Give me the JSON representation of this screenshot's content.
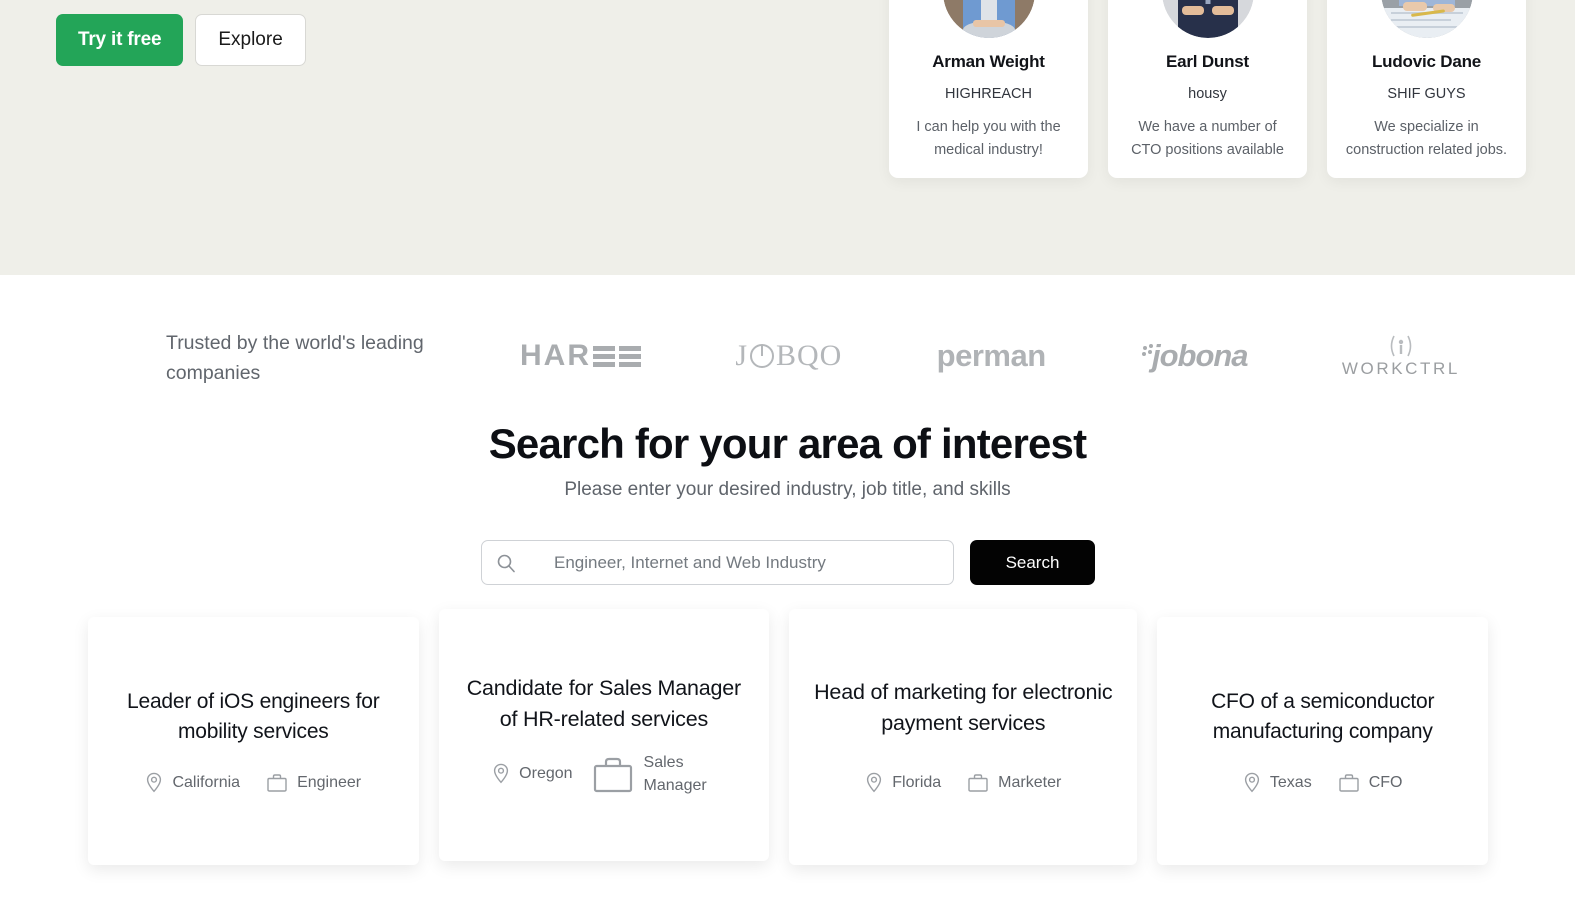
{
  "hero": {
    "primary_cta": "Try it free",
    "secondary_cta": "Explore",
    "background_color": "#efefe9"
  },
  "person_cards": [
    {
      "name": "Arman Weight",
      "company": "HIGHREACH",
      "quote": "I can help you with the medical industry!",
      "avatar": "avatar-photo-woman-denim"
    },
    {
      "name": "Earl Dunst",
      "company": "housy",
      "quote": "We have a number of CTO positions available",
      "avatar": "avatar-photo-man-suit"
    },
    {
      "name": "Ludovic Dane",
      "company": "SHIF GUYS",
      "quote": "We specialize in construction related jobs.",
      "avatar": "avatar-photo-person-desk"
    }
  ],
  "trusted": {
    "label": "Trusted by the world's leading companies",
    "logos": [
      {
        "name": "HAREE",
        "icon": "haree-logo"
      },
      {
        "name": "JOBQO",
        "icon": "jobqo-logo"
      },
      {
        "name": "perman",
        "icon": "perman-logo"
      },
      {
        "name": "jobona",
        "icon": "jobona-logo"
      },
      {
        "name": "WORKCTRL",
        "icon": "workctrl-logo"
      }
    ]
  },
  "search": {
    "title": "Search for your area of interest",
    "subtitle": "Please enter your desired industry, job title, and skills",
    "placeholder": "Engineer, Internet and Web Industry",
    "value": "",
    "button_label": "Search",
    "button_color": "#030303"
  },
  "job_cards": [
    {
      "title": "Leader of iOS engineers for mobility services",
      "location": "California",
      "role": "Engineer"
    },
    {
      "title": "Candidate for Sales Manager of HR-related services",
      "location": "Oregon",
      "role": "Sales Manager"
    },
    {
      "title": "Head of marketing for electronic payment services",
      "location": "Florida",
      "role": "Marketer"
    },
    {
      "title": "CFO of a semiconductor manufacturing company",
      "location": "Texas",
      "role": "CFO"
    }
  ],
  "colors": {
    "accent_green": "#23a558",
    "hero_bg": "#efefe9",
    "text_dark": "#11141a",
    "text_muted": "#63676d"
  }
}
